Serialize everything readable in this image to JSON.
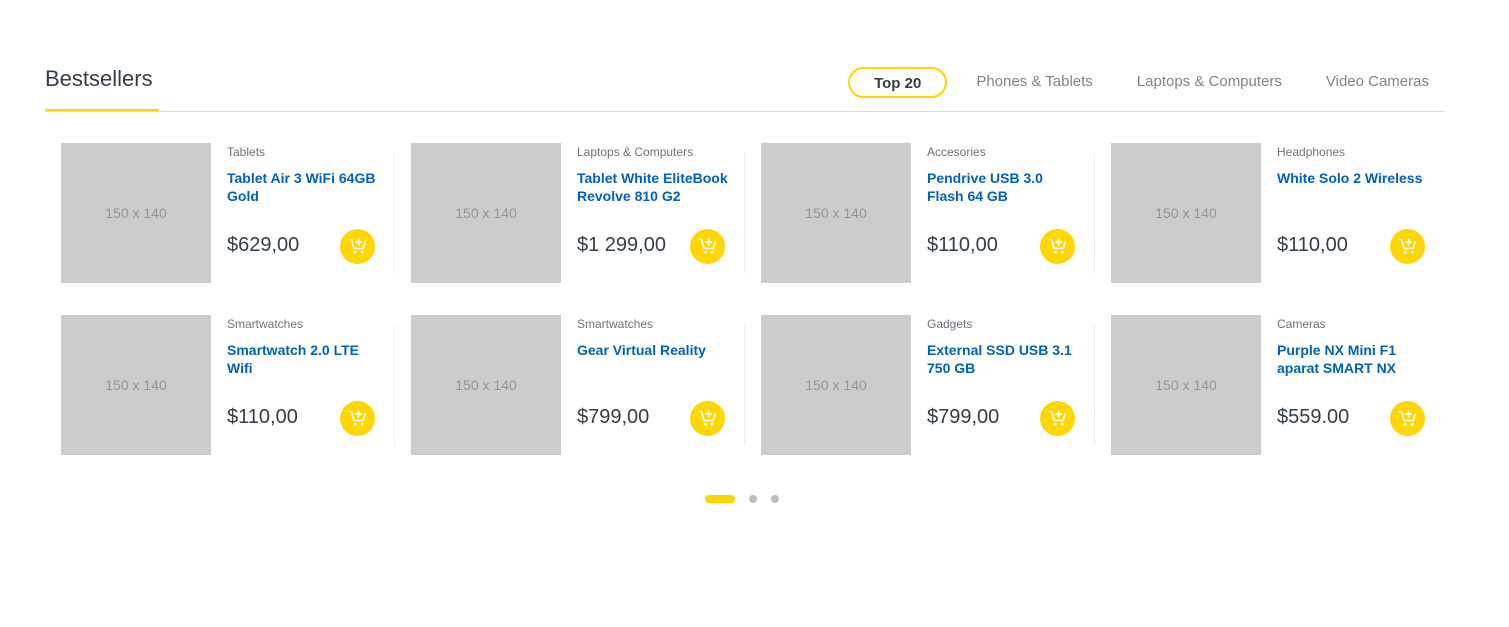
{
  "section": {
    "title": "Bestsellers"
  },
  "tabs": [
    {
      "label": "Top 20",
      "active": true
    },
    {
      "label": "Phones & Tablets",
      "active": false
    },
    {
      "label": "Laptops & Computers",
      "active": false
    },
    {
      "label": "Video Cameras",
      "active": false
    }
  ],
  "products": [
    {
      "thumb": "150 x 140",
      "category": "Tablets",
      "name": "Tablet Air 3 WiFi 64GB Gold",
      "price": "$629,00"
    },
    {
      "thumb": "150 x 140",
      "category": "Laptops & Computers",
      "name": "Tablet White EliteBook Revolve 810 G2",
      "price": "$1 299,00"
    },
    {
      "thumb": "150 x 140",
      "category": "Accesories",
      "name": "Pendrive USB 3.0 Flash 64 GB",
      "price": "$110,00"
    },
    {
      "thumb": "150 x 140",
      "category": "Headphones",
      "name": "White Solo 2 Wireless",
      "price": "$110,00"
    },
    {
      "thumb": "150 x 140",
      "category": "Smartwatches",
      "name": "Smartwatch 2.0 LTE Wifi",
      "price": "$110,00"
    },
    {
      "thumb": "150 x 140",
      "category": "Smartwatches",
      "name": "Gear Virtual Reality",
      "price": "$799,00"
    },
    {
      "thumb": "150 x 140",
      "category": "Gadgets",
      "name": "External SSD USB 3.1 750 GB",
      "price": "$799,00"
    },
    {
      "thumb": "150 x 140",
      "category": "Cameras",
      "name": "Purple NX Mini F1 aparat SMART NX",
      "price": "$559.00"
    }
  ],
  "pagination": {
    "pages": 3,
    "active_page": 1
  },
  "colors": {
    "accent": "#fed700",
    "link": "#0062bd",
    "text": "#333e48",
    "muted": "#848484",
    "placeholder": "#cccccc"
  },
  "icons": {
    "cart": "add-to-cart-icon"
  }
}
